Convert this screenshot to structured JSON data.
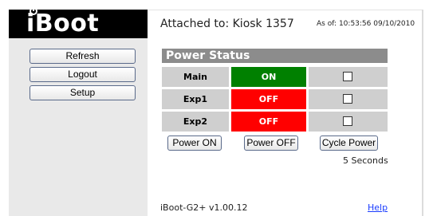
{
  "logo": {
    "text": "Boot",
    "prefix": "i"
  },
  "sidebar": {
    "buttons": [
      {
        "label": "Refresh"
      },
      {
        "label": "Logout"
      },
      {
        "label": "Setup"
      }
    ]
  },
  "header": {
    "attached": "Attached to: Kiosk 1357",
    "as_of": "As of: 10:53:56 09/10/2010"
  },
  "power_status": {
    "title": "Power Status",
    "rows": [
      {
        "label": "Main",
        "state": "ON",
        "color": "#008000"
      },
      {
        "label": "Exp1",
        "state": "OFF",
        "color": "#ff0000"
      },
      {
        "label": "Exp2",
        "state": "OFF",
        "color": "#ff0000"
      }
    ],
    "actions": {
      "power_on": "Power ON",
      "power_off": "Power OFF",
      "cycle_power": "Cycle Power"
    },
    "cycle_note": "5 Seconds"
  },
  "footer": {
    "version": "iBoot-G2+ v1.00.12",
    "help": "Help"
  }
}
